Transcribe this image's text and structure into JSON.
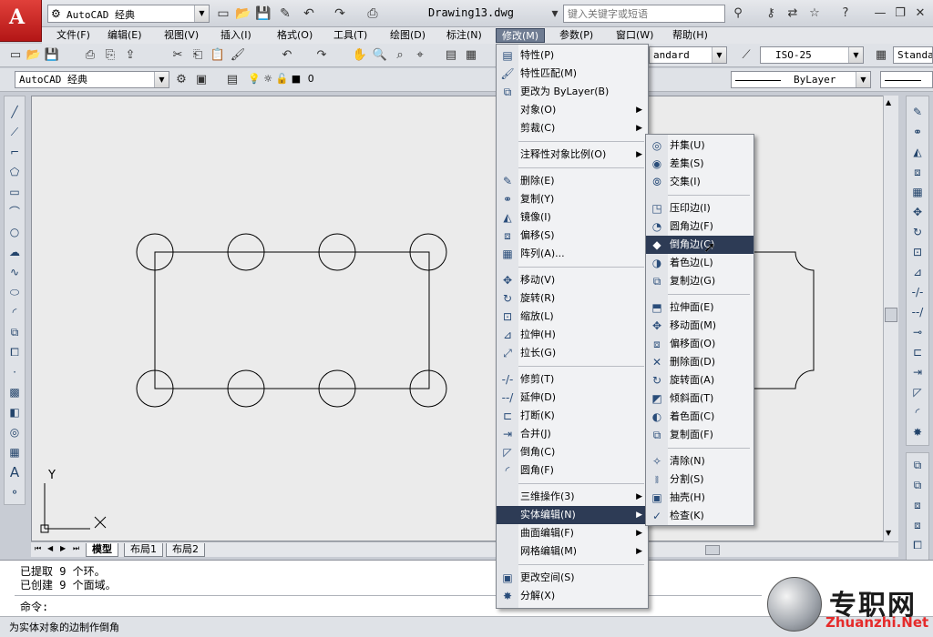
{
  "titlebar": {
    "workspace": "AutoCAD 经典",
    "document": "Drawing13.dwg",
    "search_placeholder": "键入关键字或短语"
  },
  "menubar": {
    "items": [
      "文件(F)",
      "编辑(E)",
      "视图(V)",
      "插入(I)",
      "格式(O)",
      "工具(T)",
      "绘图(D)",
      "标注(N)",
      "修改(M)",
      "参数(P)",
      "窗口(W)",
      "帮助(H)"
    ],
    "active": "修改(M)"
  },
  "toolbars": {
    "workspace_combo": "AutoCAD 经典",
    "layer_value": "0",
    "text_style": "andard",
    "dim_style": "ISO-25",
    "table_style": "Standa",
    "linetype": "ByLayer"
  },
  "modify_menu": {
    "items": [
      {
        "label": "特性(P)",
        "icon": "properties-icon"
      },
      {
        "label": "特性匹配(M)",
        "icon": "match-properties-icon"
      },
      {
        "label": "更改为 ByLayer(B)",
        "icon": "bylayer-icon"
      },
      {
        "label": "对象(O)",
        "submenu": true
      },
      {
        "label": "剪裁(C)",
        "submenu": true
      },
      {
        "label": "注释性对象比例(O)",
        "submenu": true
      },
      {
        "label": "删除(E)",
        "icon": "erase-icon"
      },
      {
        "label": "复制(Y)",
        "icon": "copy-icon"
      },
      {
        "label": "镜像(I)",
        "icon": "mirror-icon"
      },
      {
        "label": "偏移(S)",
        "icon": "offset-icon"
      },
      {
        "label": "阵列(A)...",
        "icon": "array-icon"
      },
      {
        "label": "移动(V)",
        "icon": "move-icon"
      },
      {
        "label": "旋转(R)",
        "icon": "rotate-icon"
      },
      {
        "label": "缩放(L)",
        "icon": "scale-icon"
      },
      {
        "label": "拉伸(H)",
        "icon": "stretch-icon"
      },
      {
        "label": "拉长(G)",
        "icon": "lengthen-icon"
      },
      {
        "label": "修剪(T)",
        "icon": "trim-icon"
      },
      {
        "label": "延伸(D)",
        "icon": "extend-icon"
      },
      {
        "label": "打断(K)",
        "icon": "break-icon"
      },
      {
        "label": "合并(J)",
        "icon": "join-icon"
      },
      {
        "label": "倒角(C)",
        "icon": "chamfer-icon"
      },
      {
        "label": "圆角(F)",
        "icon": "fillet-icon"
      },
      {
        "label": "三维操作(3)",
        "submenu": true
      },
      {
        "label": "实体编辑(N)",
        "submenu": true,
        "highlighted": true
      },
      {
        "label": "曲面编辑(F)",
        "submenu": true
      },
      {
        "label": "网格编辑(M)",
        "submenu": true
      },
      {
        "label": "更改空间(S)",
        "icon": "change-space-icon"
      },
      {
        "label": "分解(X)",
        "icon": "explode-icon"
      }
    ]
  },
  "solid_edit_menu": {
    "items": [
      {
        "label": "并集(U)",
        "icon": "union-icon"
      },
      {
        "label": "差集(S)",
        "icon": "subtract-icon"
      },
      {
        "label": "交集(I)",
        "icon": "intersect-icon"
      },
      {
        "label": "压印边(I)",
        "icon": "imprint-edges-icon"
      },
      {
        "label": "圆角边(F)",
        "icon": "fillet-edges-icon"
      },
      {
        "label": "倒角边(C)",
        "icon": "chamfer-edges-icon",
        "highlighted": true
      },
      {
        "label": "着色边(L)",
        "icon": "color-edges-icon"
      },
      {
        "label": "复制边(G)",
        "icon": "copy-edges-icon"
      },
      {
        "label": "拉伸面(E)",
        "icon": "extrude-faces-icon"
      },
      {
        "label": "移动面(M)",
        "icon": "move-faces-icon"
      },
      {
        "label": "偏移面(O)",
        "icon": "offset-faces-icon"
      },
      {
        "label": "删除面(D)",
        "icon": "delete-faces-icon"
      },
      {
        "label": "旋转面(A)",
        "icon": "rotate-faces-icon"
      },
      {
        "label": "倾斜面(T)",
        "icon": "taper-faces-icon"
      },
      {
        "label": "着色面(C)",
        "icon": "color-faces-icon"
      },
      {
        "label": "复制面(F)",
        "icon": "copy-faces-icon"
      },
      {
        "label": "清除(N)",
        "icon": "clean-icon"
      },
      {
        "label": "分割(S)",
        "icon": "separate-icon"
      },
      {
        "label": "抽壳(H)",
        "icon": "shell-icon"
      },
      {
        "label": "检查(K)",
        "icon": "check-icon"
      }
    ]
  },
  "layout_tabs": [
    "模型",
    "布局1",
    "布局2"
  ],
  "command": {
    "history": [
      "已提取 9 个环。",
      "已创建 9 个面域。"
    ],
    "prompt": "命令:"
  },
  "status": {
    "text": "为实体对象的边制作倒角"
  },
  "ucs": {
    "x_label": "X",
    "y_label": "Y"
  },
  "watermark": {
    "cn": "专职网",
    "en": "Zhuanzhi.Net"
  },
  "colors": {
    "highlight": "#2d3b55",
    "active_menu": "#6f7c92",
    "logo": "#c81e1e"
  }
}
